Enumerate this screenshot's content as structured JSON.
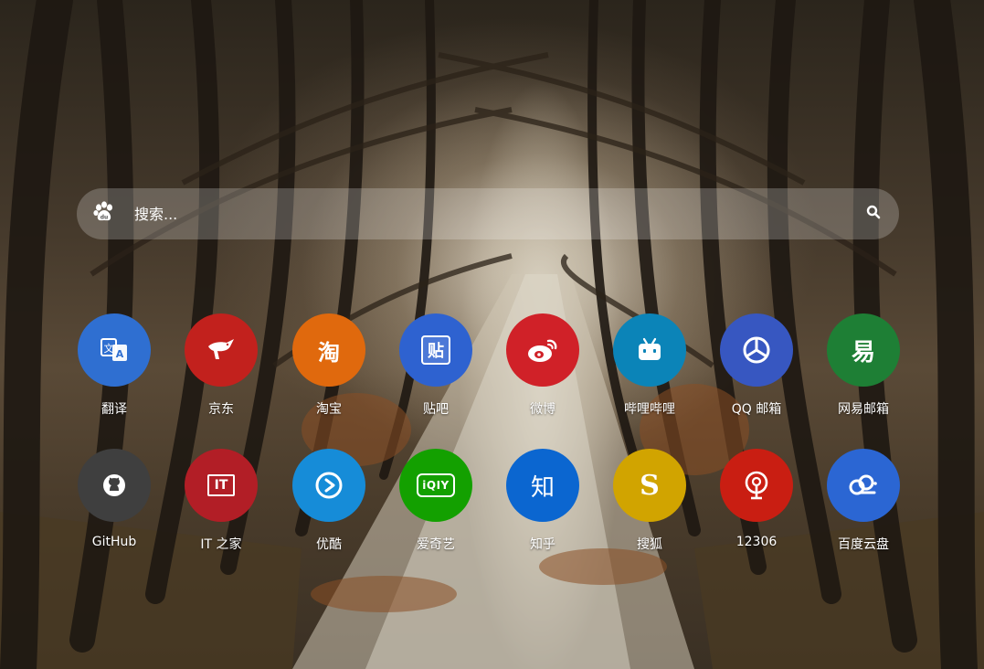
{
  "search": {
    "placeholder": "搜索...",
    "engine_icon": "baidu-paw-icon",
    "button_icon": "search-icon"
  },
  "row1": [
    {
      "label": "翻译",
      "icon": "translate-icon",
      "color": "#2f6fd1"
    },
    {
      "label": "京东",
      "icon": "jd-dog-icon",
      "color": "#c2211d"
    },
    {
      "label": "淘宝",
      "icon": "taobao-icon",
      "color": "#e0690d",
      "glyph": "淘"
    },
    {
      "label": "贴吧",
      "icon": "tieba-icon",
      "color": "#2e62d0",
      "glyph": "贴"
    },
    {
      "label": "微博",
      "icon": "weibo-icon",
      "color": "#d02128"
    },
    {
      "label": "哔哩哔哩",
      "icon": "bilibili-tv-icon",
      "color": "#0b84b8"
    },
    {
      "label": "QQ 邮箱",
      "icon": "qq-mail-icon",
      "color": "#3757c1"
    },
    {
      "label": "网易邮箱",
      "icon": "netease-mail-icon",
      "color": "#1e7f35",
      "glyph": "易"
    }
  ],
  "row2": [
    {
      "label": "GitHub",
      "icon": "github-icon",
      "color": "#3f3f3f"
    },
    {
      "label": "IT 之家",
      "icon": "ithome-icon",
      "color": "#b21e26",
      "glyph": "IT"
    },
    {
      "label": "优酷",
      "icon": "youku-icon",
      "color": "#168cd8"
    },
    {
      "label": "爱奇艺",
      "icon": "iqiyi-icon",
      "color": "#13a000",
      "glyph": "iQIY"
    },
    {
      "label": "知乎",
      "icon": "zhihu-icon",
      "color": "#0b66d0",
      "glyph": "知"
    },
    {
      "label": "搜狐",
      "icon": "sohu-icon",
      "color": "#d1a400",
      "glyph": "S"
    },
    {
      "label": "12306",
      "icon": "railway-12306-icon",
      "color": "#c91e12"
    },
    {
      "label": "百度云盘",
      "icon": "baidu-cloud-icon",
      "color": "#2b66d3"
    }
  ]
}
